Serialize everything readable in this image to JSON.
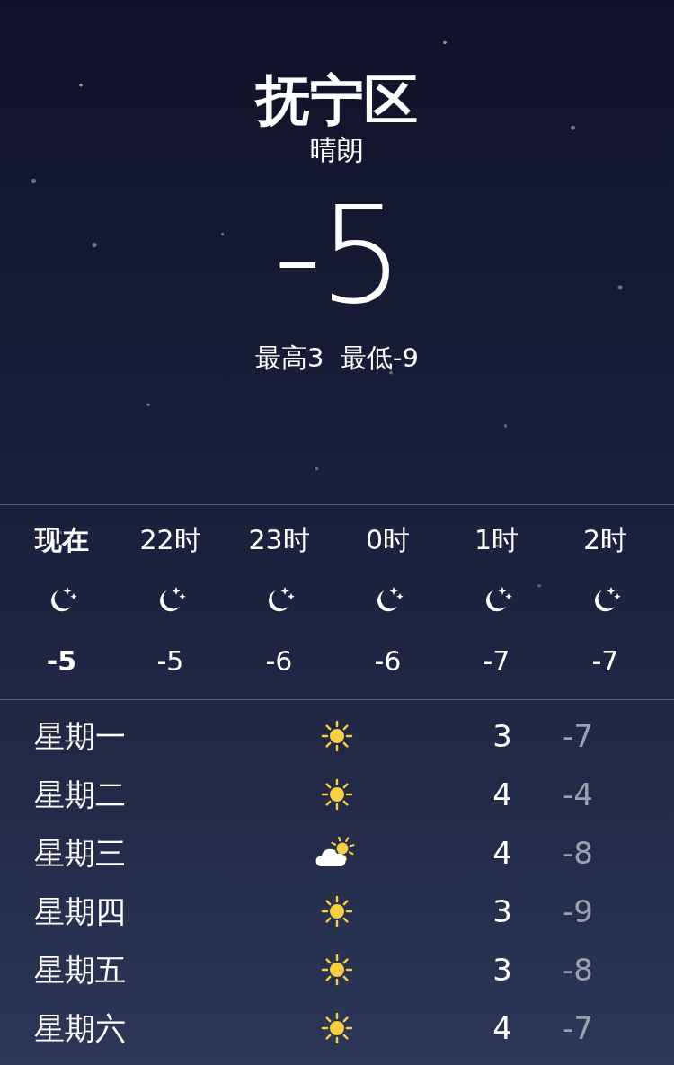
{
  "location": {
    "city": "抚宁区",
    "condition": "晴朗",
    "temperature": "-5",
    "high_low": "最高3  最低-9"
  },
  "hourly": [
    {
      "time": "现在",
      "temp": "-5",
      "current": true
    },
    {
      "time": "22时",
      "temp": "-5",
      "current": false
    },
    {
      "time": "23时",
      "temp": "-6",
      "current": false
    },
    {
      "time": "0时",
      "temp": "-6",
      "current": false
    },
    {
      "time": "1时",
      "temp": "-7",
      "current": false
    },
    {
      "time": "2时",
      "temp": "-7",
      "current": false
    }
  ],
  "daily": [
    {
      "day": "星期一",
      "kind": "sun",
      "high": "3",
      "low": "-7"
    },
    {
      "day": "星期二",
      "kind": "sun",
      "high": "4",
      "low": "-4"
    },
    {
      "day": "星期三",
      "kind": "cloudy",
      "high": "4",
      "low": "-8"
    },
    {
      "day": "星期四",
      "kind": "sun",
      "high": "3",
      "low": "-9"
    },
    {
      "day": "星期五",
      "kind": "sun",
      "high": "3",
      "low": "-8"
    },
    {
      "day": "星期六",
      "kind": "sun",
      "high": "4",
      "low": "-7"
    }
  ]
}
